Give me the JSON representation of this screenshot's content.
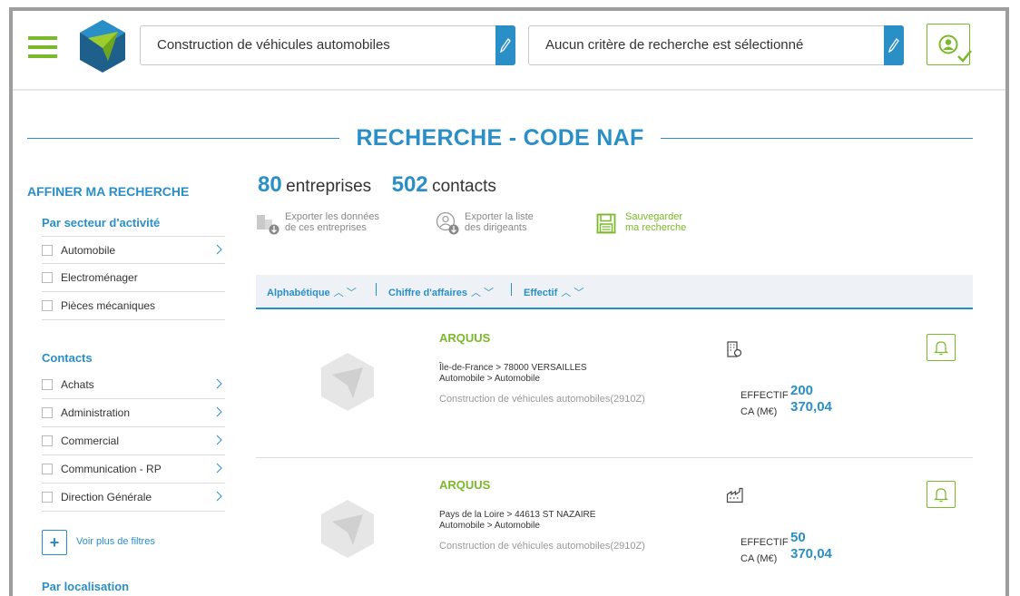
{
  "header": {
    "search_activity": "Construction de véhicules automobiles",
    "search_criteria": "Aucun critère de recherche est sélectionné"
  },
  "page_title": "RECHERCHE - CODE NAF",
  "sidebar": {
    "title": "AFFINER MA RECHERCHE",
    "sector_heading": "Par secteur d'activité",
    "sector_items": [
      {
        "label": "Automobile",
        "has_children": true
      },
      {
        "label": "Electroménager",
        "has_children": false
      },
      {
        "label": "Pièces mécaniques",
        "has_children": false
      }
    ],
    "contacts_heading": "Contacts",
    "contact_items": [
      {
        "label": "Achats"
      },
      {
        "label": "Administration"
      },
      {
        "label": "Commercial"
      },
      {
        "label": "Communication - RP"
      },
      {
        "label": "Direction Générale"
      }
    ],
    "more_filters_label": "Voir plus de filtres",
    "location_heading": "Par localisation"
  },
  "results": {
    "companies_count": "80",
    "companies_label": "entreprises",
    "contacts_count": "502",
    "contacts_label": "contacts"
  },
  "actions": {
    "export_companies": [
      "Exporter les données",
      "de ces entreprises"
    ],
    "export_leaders": [
      "Exporter la liste",
      "des dirigeants"
    ],
    "save_search": [
      "Sauvegarder",
      "ma recherche"
    ]
  },
  "sort": {
    "alpha": "Alphabétique",
    "revenue": "Chiffre d'affaires",
    "staff": "Effectif",
    "arrows": "︿ ﹀"
  },
  "companies": [
    {
      "name": "ARQUUS",
      "address": "Île-de-France > 78000  VERSAILLES",
      "sector": "Automobile > Automobile",
      "naf": "Construction de véhicules automobiles(2910Z)",
      "type_icon": "office-building-icon",
      "effectif_label": "EFFECTIF",
      "effectif": "200",
      "ca_label": "CA (M€)",
      "ca": "370,04"
    },
    {
      "name": "ARQUUS",
      "address": "Pays de la Loire > 44613  ST NAZAIRE",
      "sector": "Automobile > Automobile",
      "naf": "Construction de véhicules automobiles(2910Z)",
      "type_icon": "factory-icon",
      "effectif_label": "EFFECTIF",
      "effectif": "50",
      "ca_label": "CA (M€)",
      "ca": "370,04"
    }
  ],
  "colors": {
    "primary_blue": "#2a8fc7",
    "green": "#7ab929"
  }
}
